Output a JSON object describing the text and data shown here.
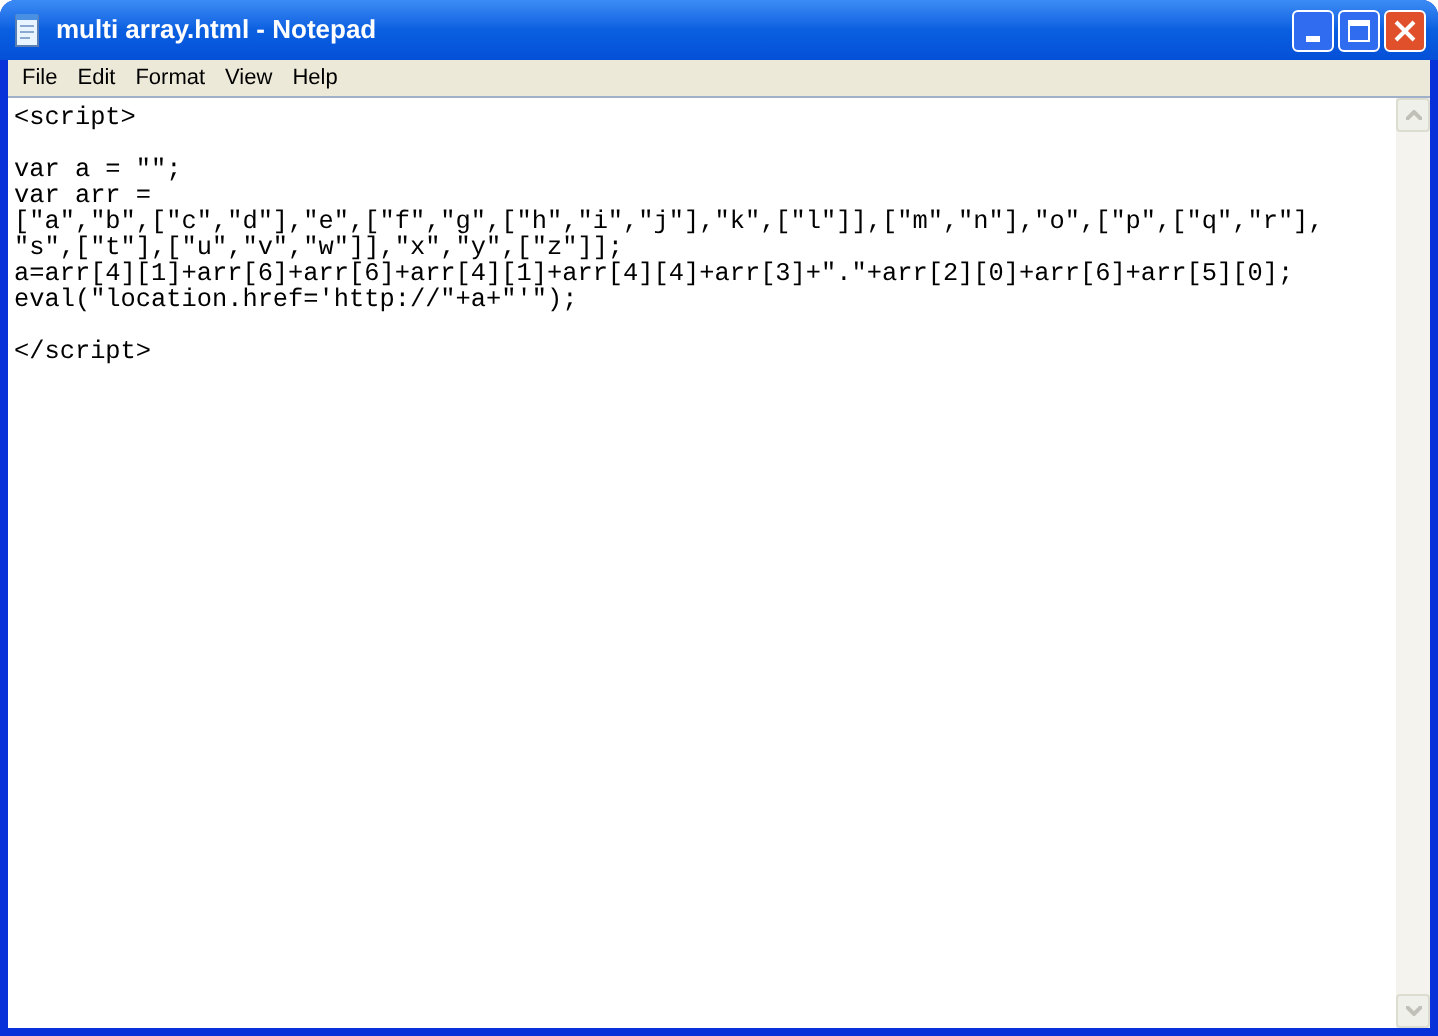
{
  "window": {
    "title": "multi array.html - Notepad"
  },
  "menu": [
    {
      "label": "File"
    },
    {
      "label": "Edit"
    },
    {
      "label": "Format"
    },
    {
      "label": "View"
    },
    {
      "label": "Help"
    }
  ],
  "editor": {
    "text": "<script>\n\nvar a = \"\";\nvar arr =\n[\"a\",\"b\",[\"c\",\"d\"],\"e\",[\"f\",\"g\",[\"h\",\"i\",\"j\"],\"k\",[\"l\"]],[\"m\",\"n\"],\"o\",[\"p\",[\"q\",\"r\"],\n\"s\",[\"t\"],[\"u\",\"v\",\"w\"]],\"x\",\"y\",[\"z\"]];\na=arr[4][1]+arr[6]+arr[6]+arr[4][1]+arr[4][4]+arr[3]+\".\"+arr[2][0]+arr[6]+arr[5][0];\neval(\"location.href='http://\"+a+\"'\");\n\n</script>"
  }
}
